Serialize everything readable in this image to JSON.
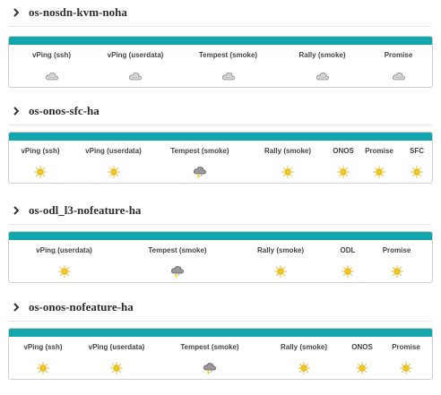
{
  "sections": [
    {
      "title": "os-nosdn-kvm-noha",
      "columns": [
        "vPing (ssh)",
        "vPing (userdata)",
        "Tempest (smoke)",
        "Rally (smoke)",
        "Promise"
      ],
      "icons": [
        "cloudy-icon",
        "cloudy-icon",
        "cloudy-icon",
        "cloudy-icon",
        "cloudy-icon"
      ]
    },
    {
      "title": "os-onos-sfc-ha",
      "columns": [
        "vPing (ssh)",
        "vPing (userdata)",
        "Tempest (smoke)",
        "Rally (smoke)",
        "ONOS",
        "Promise",
        "SFC"
      ],
      "icons": [
        "sunny-icon",
        "sunny-icon",
        "storm-icon",
        "sunny-icon",
        "sunny-icon",
        "sunny-icon",
        "sunny-icon"
      ]
    },
    {
      "title": "os-odl_l3-nofeature-ha",
      "columns": [
        "vPing (userdata)",
        "Tempest (smoke)",
        "Rally (smoke)",
        "ODL",
        "Promise"
      ],
      "icons": [
        "sunny-icon",
        "storm-icon",
        "sunny-icon",
        "sunny-icon",
        "sunny-icon"
      ]
    },
    {
      "title": "os-onos-nofeature-ha",
      "columns": [
        "vPing (ssh)",
        "vPing (userdata)",
        "Tempest (smoke)",
        "Rally (smoke)",
        "ONOS",
        "Promise"
      ],
      "icons": [
        "sunny-icon",
        "sunny-icon",
        "storm-icon",
        "sunny-icon",
        "sunny-icon",
        "sunny-icon"
      ]
    }
  ],
  "colors": {
    "accent": "#14a6ad",
    "sun": "#f2c81a",
    "cloud": "#bfbfbf"
  }
}
